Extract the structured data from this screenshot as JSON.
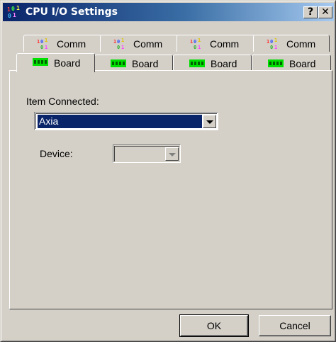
{
  "window": {
    "title": "CPU I/O Settings",
    "help_label": "?",
    "close_label": "✕",
    "app_icon": "io-digits-icon"
  },
  "tabs": {
    "comm": [
      {
        "label": "Comm",
        "icon": "comm-icon"
      },
      {
        "label": "Comm",
        "icon": "comm-icon"
      },
      {
        "label": "Comm",
        "icon": "comm-icon"
      },
      {
        "label": "Comm",
        "icon": "comm-icon"
      }
    ],
    "board": [
      {
        "label": "Board",
        "icon": "board-icon",
        "selected": true
      },
      {
        "label": "Board",
        "icon": "board-icon",
        "selected": false
      },
      {
        "label": "Board",
        "icon": "board-icon",
        "selected": false
      },
      {
        "label": "Board",
        "icon": "board-icon",
        "selected": false
      }
    ]
  },
  "panel": {
    "item_connected_label": "Item Connected:",
    "item_connected_value": "Axia",
    "device_label": "Device:",
    "device_value": ""
  },
  "buttons": {
    "ok": "OK",
    "cancel": "Cancel"
  },
  "colors": {
    "face": "#d4d0c8",
    "title_start": "#0a246a",
    "title_end": "#a6caf0",
    "selection": "#0a246a",
    "board_green": "#00e000"
  }
}
